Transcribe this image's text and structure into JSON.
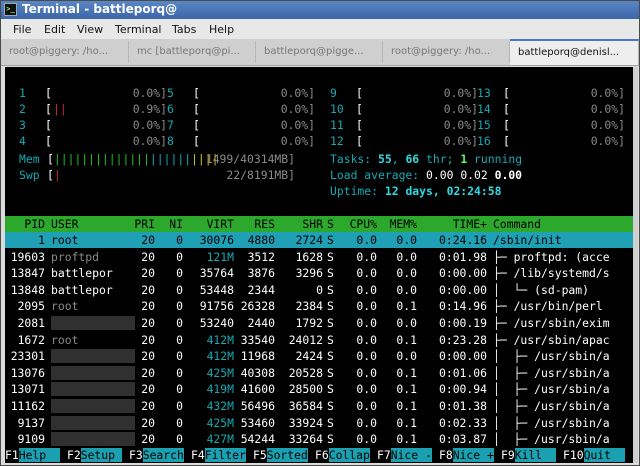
{
  "window": {
    "title": "Terminal - battleporq@",
    "menus": [
      "File",
      "Edit",
      "View",
      "Terminal",
      "Tabs",
      "Help"
    ],
    "tabs": [
      {
        "label": "root@piggery: /ho..."
      },
      {
        "label": "mc [battleporq@pi..."
      },
      {
        "label": "battleporq@pigge..."
      },
      {
        "label": "root@piggery: /ho..."
      },
      {
        "label": "battleporq@denisl..."
      }
    ]
  },
  "meters": {
    "cpus": [
      {
        "num": "1",
        "bar": "",
        "pct": "0.0%]"
      },
      {
        "num": "2",
        "bar": "||",
        "pct": "0.9%]"
      },
      {
        "num": "3",
        "bar": "",
        "pct": "0.0%]"
      },
      {
        "num": "4",
        "bar": "",
        "pct": "0.0%]"
      },
      {
        "num": "5",
        "bar": "",
        "pct": "0.0%]"
      },
      {
        "num": "6",
        "bar": "",
        "pct": "0.0%]"
      },
      {
        "num": "7",
        "bar": "",
        "pct": "0.0%]"
      },
      {
        "num": "8",
        "bar": "",
        "pct": "0.0%]"
      },
      {
        "num": "9",
        "bar": "",
        "pct": "0.0%]"
      },
      {
        "num": "10",
        "bar": "",
        "pct": "0.0%]"
      },
      {
        "num": "11",
        "bar": "",
        "pct": "0.0%]"
      },
      {
        "num": "12",
        "bar": "",
        "pct": "0.0%]"
      },
      {
        "num": "13",
        "bar": "",
        "pct": "0.0%]"
      },
      {
        "num": "14",
        "bar": "",
        "pct": "0.0%]"
      },
      {
        "num": "15",
        "bar": "",
        "pct": "0.0%]"
      },
      {
        "num": "16",
        "bar": "",
        "pct": "0.0%]"
      }
    ],
    "mem": {
      "label": "Mem",
      "bar": "[||||||||||||||||||||||||",
      "value": "1499/40314MB]"
    },
    "swp": {
      "label": "Swp",
      "bar": "[|",
      "value": "22/8191MB]"
    },
    "tasks": {
      "label": "Tasks: ",
      "count": "55",
      "sep": ", ",
      "thr": "66",
      "thr_label": " thr; ",
      "running": "1",
      "running_label": " running"
    },
    "load": {
      "label": "Load average: ",
      "l1": "0.00",
      "l5": "0.02",
      "l15": "0.00"
    },
    "uptime": {
      "label": "Uptime: ",
      "value": "12 days, 02:24:58"
    }
  },
  "table": {
    "headers": {
      "pid": "PID",
      "user": "USER",
      "pri": "PRI",
      "ni": "NI",
      "virt": "VIRT",
      "res": "RES",
      "shr": "SHR",
      "s": "S",
      "cpu": "CPU%",
      "mem": "MEM%",
      "time": "TIME+",
      "command": "Command"
    },
    "rows": [
      {
        "pid": "1",
        "user": "root",
        "pri": "20",
        "ni": "0",
        "virt": "30076",
        "res": "4880",
        "shr": "2724",
        "s": "S",
        "cpu": "0.0",
        "mem": "0.0",
        "time": "0:24.16",
        "command": "/sbin/init",
        "selected": true
      },
      {
        "pid": "19603",
        "user": "proftpd",
        "pri": "20",
        "ni": "0",
        "virt": "121M",
        "res": "3512",
        "shr": "1628",
        "s": "S",
        "cpu": "0.0",
        "mem": "0.0",
        "time": "0:01.98",
        "command": "├─ proftpd: (acce"
      },
      {
        "pid": "13847",
        "user": "battlepor",
        "pri": "20",
        "ni": "0",
        "virt": "35764",
        "res": "3876",
        "shr": "3296",
        "s": "S",
        "cpu": "0.0",
        "mem": "0.0",
        "time": "0:00.00",
        "command": "├─ /lib/systemd/s"
      },
      {
        "pid": "13848",
        "user": "battlepor",
        "pri": "20",
        "ni": "0",
        "virt": "53448",
        "res": "2344",
        "shr": "0",
        "s": "S",
        "cpu": "0.0",
        "mem": "0.0",
        "time": "0:00.00",
        "command": "│  └─ (sd-pam)"
      },
      {
        "pid": "2095",
        "user": "root",
        "pri": "20",
        "ni": "0",
        "virt": "91756",
        "res": "26328",
        "shr": "2384",
        "s": "S",
        "cpu": "0.0",
        "mem": "0.1",
        "time": "0:14.96",
        "command": "├─ /usr/bin/perl"
      },
      {
        "pid": "2081",
        "user": "",
        "pri": "20",
        "ni": "0",
        "virt": "53240",
        "res": "2440",
        "shr": "1792",
        "s": "S",
        "cpu": "0.0",
        "mem": "0.0",
        "time": "0:00.19",
        "command": "├─ /usr/sbin/exim"
      },
      {
        "pid": "1672",
        "user": "root",
        "pri": "20",
        "ni": "0",
        "virt": "412M",
        "res": "33540",
        "shr": "24012",
        "s": "S",
        "cpu": "0.0",
        "mem": "0.1",
        "time": "0:23.28",
        "command": "├─ /usr/sbin/apac"
      },
      {
        "pid": "23301",
        "user": "",
        "pri": "20",
        "ni": "0",
        "virt": "412M",
        "res": "11968",
        "shr": "2424",
        "s": "S",
        "cpu": "0.0",
        "mem": "0.0",
        "time": "0:00.00",
        "command": "│  ├─ /usr/sbin/a"
      },
      {
        "pid": "13076",
        "user": "",
        "pri": "20",
        "ni": "0",
        "virt": "425M",
        "res": "40308",
        "shr": "20528",
        "s": "S",
        "cpu": "0.0",
        "mem": "0.1",
        "time": "0:01.06",
        "command": "│  ├─ /usr/sbin/a"
      },
      {
        "pid": "13071",
        "user": "",
        "pri": "20",
        "ni": "0",
        "virt": "419M",
        "res": "41600",
        "shr": "28500",
        "s": "S",
        "cpu": "0.0",
        "mem": "0.1",
        "time": "0:00.94",
        "command": "│  ├─ /usr/sbin/a"
      },
      {
        "pid": "11162",
        "user": "",
        "pri": "20",
        "ni": "0",
        "virt": "432M",
        "res": "56496",
        "shr": "36584",
        "s": "S",
        "cpu": "0.0",
        "mem": "0.1",
        "time": "0:01.38",
        "command": "│  ├─ /usr/sbin/a"
      },
      {
        "pid": "9137",
        "user": "",
        "pri": "20",
        "ni": "0",
        "virt": "425M",
        "res": "53460",
        "shr": "33924",
        "s": "S",
        "cpu": "0.0",
        "mem": "0.1",
        "time": "0:02.33",
        "command": "│  ├─ /usr/sbin/a"
      },
      {
        "pid": "9109",
        "user": "",
        "pri": "20",
        "ni": "0",
        "virt": "427M",
        "res": "54244",
        "shr": "33264",
        "s": "S",
        "cpu": "0.0",
        "mem": "0.1",
        "time": "0:03.87",
        "command": "│  ├─ /usr/sbin/a"
      }
    ]
  },
  "fkeys": [
    {
      "num": "F1",
      "label": "Help  "
    },
    {
      "num": "F2",
      "label": "Setup "
    },
    {
      "num": "F3",
      "label": "Search"
    },
    {
      "num": "F4",
      "label": "Filter"
    },
    {
      "num": "F5",
      "label": "Sorted"
    },
    {
      "num": "F6",
      "label": "Collap"
    },
    {
      "num": "F7",
      "label": "Nice -"
    },
    {
      "num": "F8",
      "label": "Nice +"
    },
    {
      "num": "F9",
      "label": "Kill  "
    },
    {
      "num": "F10",
      "label": "Quit  "
    }
  ],
  "colors": {
    "header_bg": "#2ca82c",
    "selected_bg": "#20a0b4",
    "fkey_bg": "#1aa0b0",
    "titlebar": "#4a78c0"
  }
}
